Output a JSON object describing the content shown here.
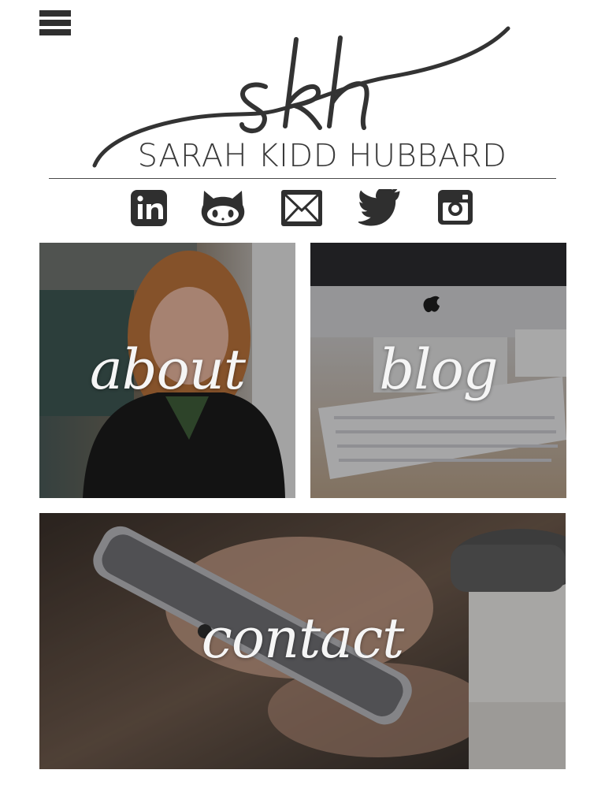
{
  "header": {
    "monogram": "skh",
    "name": "SARAH KIDD HUBBARD"
  },
  "social": [
    {
      "icon": "linkedin-icon"
    },
    {
      "icon": "github-icon"
    },
    {
      "icon": "email-icon"
    },
    {
      "icon": "twitter-icon"
    },
    {
      "icon": "instagram-icon"
    }
  ],
  "tiles": {
    "about": "about",
    "blog": "blog",
    "contact": "contact"
  },
  "colors": {
    "text_dark": "#2f2f2f",
    "tile_label": "#f5f5f5"
  }
}
